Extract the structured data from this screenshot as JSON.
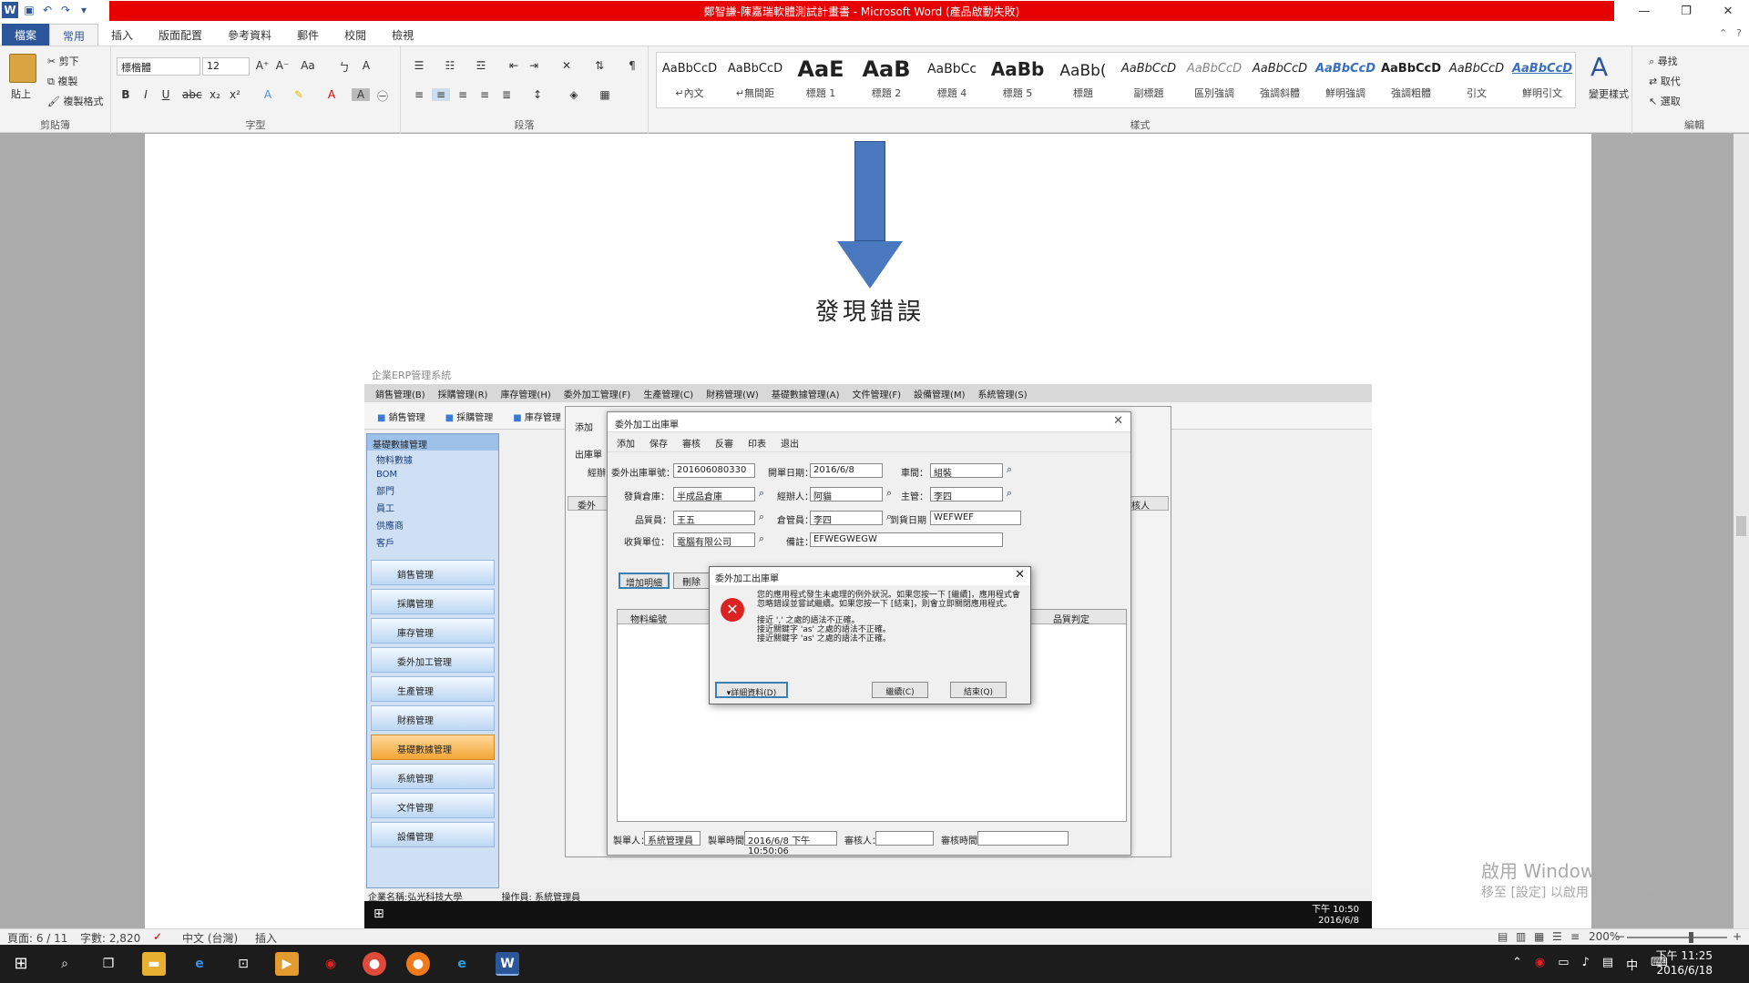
{
  "window": {
    "title": "鄭智謙-陳嘉瑞軟體測試計畫書 - Microsoft Word (產品啟動失敗)",
    "minimize": "—",
    "restore": "❐",
    "close": "✕"
  },
  "tabs": [
    "檔案",
    "常用",
    "插入",
    "版面配置",
    "參考資料",
    "郵件",
    "校閱",
    "檢視"
  ],
  "ribbon": {
    "clipboard": {
      "paste": "貼上",
      "cut": "剪下",
      "copy": "複製",
      "format_painter": "複製格式",
      "label": "剪貼簿"
    },
    "font": {
      "name": "標楷體",
      "size": "12",
      "label": "字型"
    },
    "paragraph": {
      "label": "段落"
    },
    "styles": {
      "label": "樣式",
      "items": [
        {
          "preview": "AaBbCcD",
          "name": "↵內文"
        },
        {
          "preview": "AaBbCcD",
          "name": "↵無間距"
        },
        {
          "preview": "AaE",
          "name": "標題 1"
        },
        {
          "preview": "AaB",
          "name": "標題 2"
        },
        {
          "preview": "AaBbCc",
          "name": "標題 4"
        },
        {
          "preview": "AaBb",
          "name": "標題 5"
        },
        {
          "preview": "AaBb(",
          "name": "標題"
        },
        {
          "preview": "AaBbCcD",
          "name": "副標題"
        },
        {
          "preview": "AaBbCcD",
          "name": "區別強調"
        },
        {
          "preview": "AaBbCcD",
          "name": "強調斜體"
        },
        {
          "preview": "AaBbCcD",
          "name": "鮮明強調"
        },
        {
          "preview": "AaBbCcD",
          "name": "強調粗體"
        },
        {
          "preview": "AaBbCcD",
          "name": "引文"
        },
        {
          "preview": "AaBbCcD",
          "name": "鮮明引文"
        }
      ],
      "change": "變更樣式"
    },
    "editing": {
      "find": "尋找",
      "replace": "取代",
      "select": "選取",
      "label": "編輯"
    }
  },
  "document": {
    "heading": "發現錯誤"
  },
  "erp": {
    "title": "企業ERP管理系統",
    "menu": [
      "銷售管理(B)",
      "採購管理(R)",
      "庫存管理(H)",
      "委外加工管理(F)",
      "生產管理(C)",
      "財務管理(W)",
      "基礎數據管理(A)",
      "文件管理(F)",
      "設備管理(M)",
      "系統管理(S)"
    ],
    "toolbar": [
      "銷售管理",
      "採購管理",
      "庫存管理"
    ],
    "side_header": "基礎數據管理",
    "side_sub": [
      "物料數據",
      "BOM",
      "部門",
      "員工",
      "供應商",
      "客戶"
    ],
    "side_buttons": [
      "銷售管理",
      "採購管理",
      "庫存管理",
      "委外加工管理",
      "生產管理",
      "財務管理",
      "基礎數據管理",
      "系統管理",
      "文件管理",
      "設備管理"
    ],
    "status_company": "企業名稱:弘光科技大學",
    "status_operator": "操作員: 系統管理員",
    "taskbar_time": "下午 10:50",
    "taskbar_date": "2016/6/8"
  },
  "form": {
    "title": "委外加工出庫單",
    "toolbar": [
      "添加",
      "保存",
      "審核",
      "反審",
      "印表",
      "退出"
    ],
    "labels": {
      "order_no": "委外出庫單號：",
      "order_date": "開單日期：",
      "workshop": "車間：",
      "warehouse": "發貨倉庫：",
      "handler": "經辦人：",
      "supervisor": "主管：",
      "qc": "品質員：",
      "keeper": "倉管員：",
      "arrive": "到貨日期",
      "receiver": "收貨單位：",
      "remark": "備註：",
      "maker": "製單人：",
      "make_time": "製單時間：",
      "auditor": "審核人：",
      "audit_time": "審核時間："
    },
    "values": {
      "order_no": "201606080330",
      "order_date": "2016/6/8",
      "workshop": "組裝",
      "warehouse": "半成品倉庫",
      "handler": "阿貓",
      "supervisor": "李四",
      "qc": "王五",
      "keeper": "李四",
      "arrive": "WEFWEF",
      "receiver": "電腦有限公司",
      "remark": "EFWEGWEGW",
      "maker": "系統管理員",
      "make_time": "2016/6/8 下午 10:50:06"
    },
    "buttons": {
      "add_detail": "增加明細",
      "delete": "刪除"
    },
    "grid_headers": [
      "物料編號",
      "品質判定"
    ],
    "bg_left_labels": [
      "出庫單",
      "經辦"
    ],
    "bg_headers": [
      "委外",
      "審核人"
    ],
    "bg_toolbar": "添加"
  },
  "error_dialog": {
    "title": "委外加工出庫單",
    "message": "您的應用程式發生未處理的例外狀況。如果您按一下 [繼續]，應用程式會忽略錯誤並嘗試繼續。如果您按一下 [結束]，則會立即關閉應用程式。",
    "details": [
      "接近 ',' 之處的語法不正確。",
      "接近關鍵字 'as' 之處的語法不正確。",
      "接近關鍵字 'as' 之處的語法不正確。"
    ],
    "btn_details": "▾詳細資料(D)",
    "btn_continue": "繼續(C)",
    "btn_quit": "結束(Q)"
  },
  "watermark": {
    "line1": "啟用 Windows",
    "line2": "移至 [設定] 以啟用 Windows。"
  },
  "statusbar": {
    "page": "頁面: 6 / 11",
    "words": "字數: 2,820",
    "lang": "中文 (台灣)",
    "mode": "插入",
    "zoom": "200%",
    "zoom_minus": "−",
    "zoom_plus": "+"
  },
  "taskbar": {
    "time": "下午 11:25",
    "date": "2016/6/18",
    "ime": "中"
  }
}
